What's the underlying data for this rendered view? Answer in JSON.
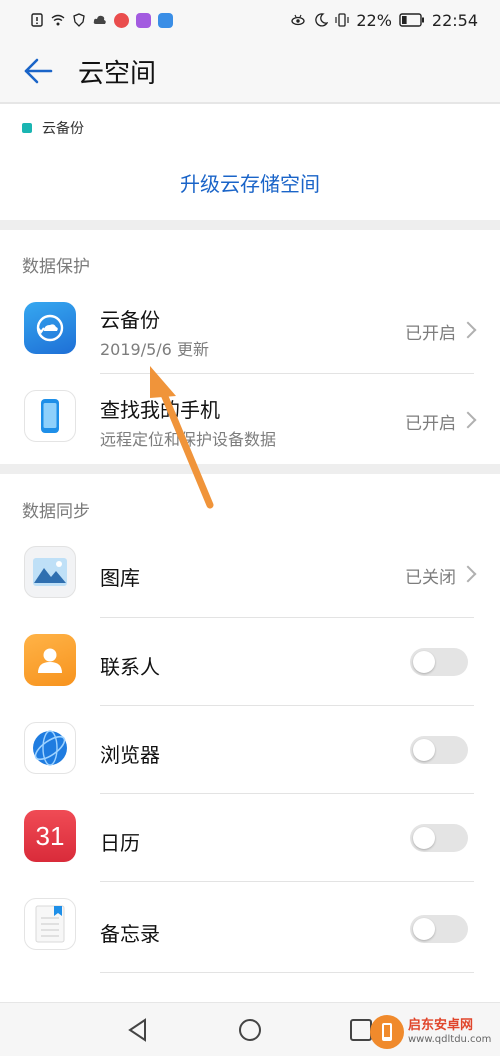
{
  "status_bar": {
    "battery_percent": "22%",
    "time": "22:54",
    "left_icons": [
      "sim-alert-icon",
      "wifi-icon",
      "vpn-shield-icon",
      "cloud-icon",
      "app-weibo-icon",
      "app-purple-icon",
      "app-blue-icon"
    ],
    "right_icons": [
      "eye-comfort-icon",
      "moon-icon",
      "vibrate-icon",
      "battery-icon"
    ]
  },
  "header": {
    "title": "云空间",
    "back_icon": "arrow-left-icon"
  },
  "storage": {
    "legend_label": "云备份",
    "legend_color": "#1ab5b2",
    "upgrade_label": "升级云存储空间",
    "upgrade_color": "#1a64c8"
  },
  "data_protection": {
    "header": "数据保护",
    "items": [
      {
        "title": "云备份",
        "subtitle": "2019/5/6 更新",
        "status": "已开启",
        "icon": "cloud-backup-icon"
      },
      {
        "title": "查找我的手机",
        "subtitle": "远程定位和保护设备数据",
        "status": "已开启",
        "icon": "find-phone-icon"
      }
    ]
  },
  "data_sync": {
    "header": "数据同步",
    "items": [
      {
        "title": "图库",
        "status": "已关闭",
        "icon": "gallery-icon"
      },
      {
        "title": "联系人",
        "toggle": false,
        "icon": "contacts-icon"
      },
      {
        "title": "浏览器",
        "toggle": false,
        "icon": "browser-icon"
      },
      {
        "title": "日历",
        "toggle": false,
        "icon": "calendar-icon",
        "icon_text": "31"
      },
      {
        "title": "备忘录",
        "toggle": false,
        "icon": "notes-icon"
      }
    ]
  },
  "nav_bar": {
    "icons": [
      "nav-back-icon",
      "nav-home-icon",
      "nav-recents-icon"
    ]
  },
  "watermark": {
    "name": "启东安卓网",
    "url": "www.qdltdu.com"
  },
  "colors": {
    "accent": "#1a64c8",
    "annotation_arrow": "#f0943a"
  }
}
